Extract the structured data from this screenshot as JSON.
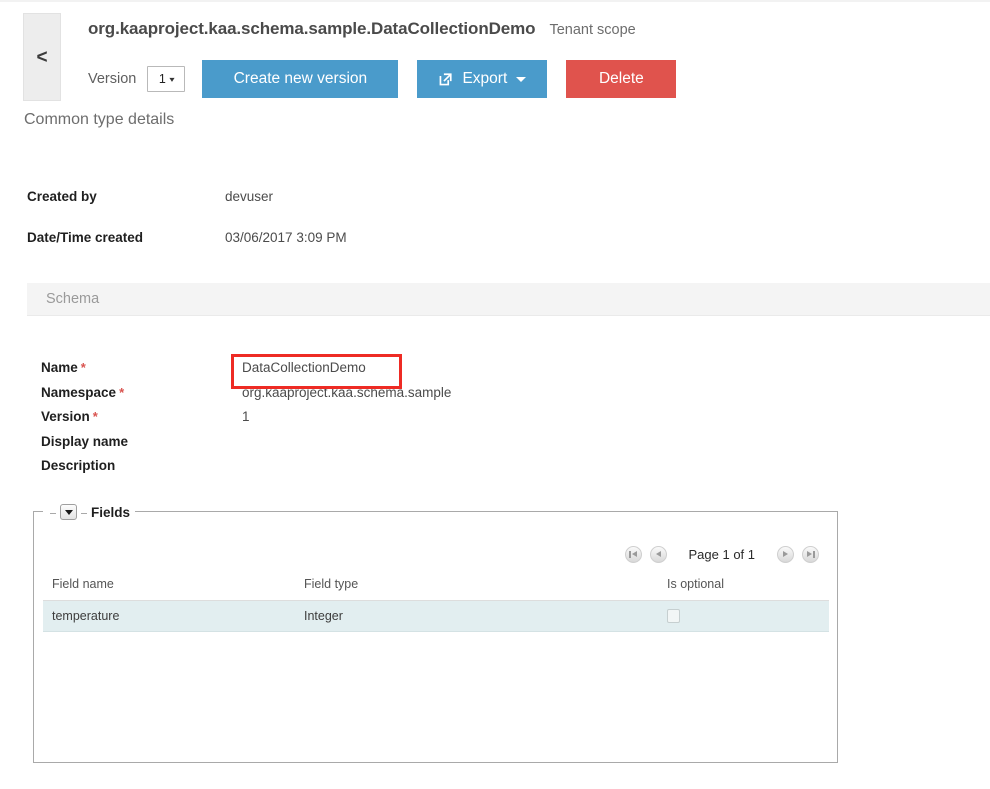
{
  "header": {
    "back_label": "<",
    "title": "org.kaaproject.kaa.schema.sample.DataCollectionDemo",
    "scope": "Tenant scope",
    "version_label": "Version",
    "version_value": "1",
    "buttons": {
      "create": "Create new version",
      "export": "Export",
      "delete": "Delete"
    },
    "colors": {
      "primary": "#4a9bcb",
      "danger": "#e0534d"
    }
  },
  "section": {
    "heading": "Common type details"
  },
  "meta": [
    {
      "label": "Created by",
      "value": "devuser"
    },
    {
      "label": "Date/Time created",
      "value": "03/06/2017 3:09 PM"
    }
  ],
  "schema": {
    "panel_title": "Schema",
    "fields": [
      {
        "label": "Name",
        "required": "*",
        "value": "DataCollectionDemo"
      },
      {
        "label": "Namespace",
        "required": "*",
        "value": "org.kaaproject.kaa.schema.sample"
      },
      {
        "label": "Version",
        "required": "*",
        "value": "1"
      },
      {
        "label": "Display name",
        "required": "",
        "value": ""
      },
      {
        "label": "Description",
        "required": "",
        "value": ""
      }
    ],
    "annotation_color": "#ee2b24"
  },
  "fields_section": {
    "legend": "Fields",
    "pager": {
      "first": "first-page",
      "prev": "previous-page",
      "text_prefix": "Page ",
      "text_current": "1",
      "text_mid": " of ",
      "text_total": "1",
      "full_text": "Page 1 of 1",
      "next": "next-page",
      "last": "last-page"
    },
    "table": {
      "columns": [
        "Field name",
        "Field type",
        "Is optional"
      ],
      "rows": [
        {
          "field_name": "temperature",
          "field_type": "Integer",
          "is_optional": false
        }
      ]
    }
  }
}
